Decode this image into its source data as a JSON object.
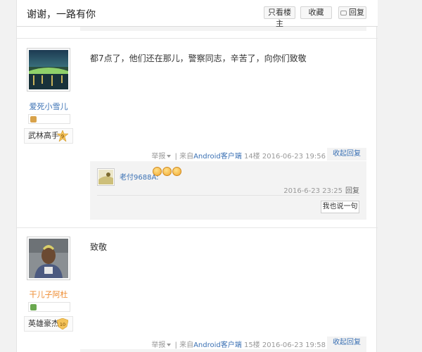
{
  "header": {
    "title": "谢谢，一路有你",
    "btn_only_op": "只看楼主",
    "btn_collect": "收藏",
    "btn_reply": "回复"
  },
  "posts": [
    {
      "username": "爱死小雪儿",
      "rank": "武林高手",
      "rank_level": "9",
      "content": "都7点了，他们还在那儿，警察同志，辛苦了，向你们致敬",
      "report": "举报",
      "source_prefix": "| 来自",
      "source_app": "Android客户端",
      "floor": "14楼",
      "datetime": "2016-06-23 19:56",
      "fold_reply": "收起回复",
      "sub_reply": {
        "username": "老付9688A:",
        "datetime": "2016-6-23 23:25",
        "reply_label": "回复",
        "say_button": "我也说一句"
      }
    },
    {
      "username": "干儿子阿杜",
      "rank": "英雄豪杰",
      "rank_level": "10",
      "content": "致敬",
      "report": "举报",
      "source_prefix": "| 来自",
      "source_app": "Android客户端",
      "floor": "15楼",
      "datetime": "2016-06-23 19:58",
      "fold_reply": "收起回复"
    }
  ],
  "colors": {
    "link_blue": "#3b71b4",
    "username_orange": "#ee8a2e",
    "muted_gray": "#999999"
  }
}
